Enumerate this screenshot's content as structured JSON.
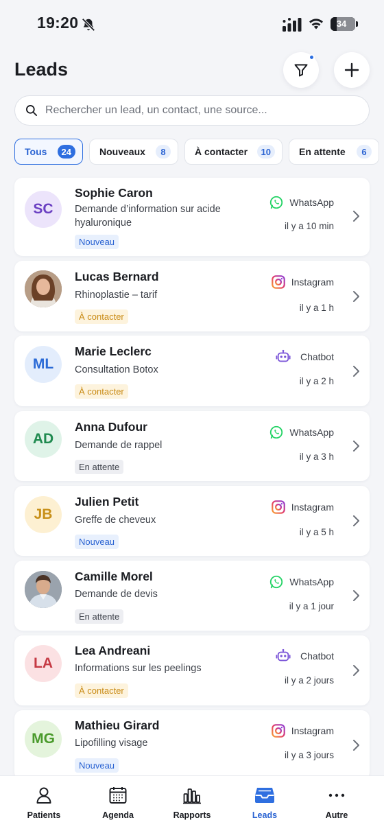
{
  "status_bar": {
    "time": "19:20",
    "battery": "34"
  },
  "header": {
    "title": "Leads"
  },
  "search": {
    "placeholder": "Rechercher un lead, un contact, une source..."
  },
  "filters": [
    {
      "label": "Tous",
      "count": "24",
      "active": true
    },
    {
      "label": "Nouveaux",
      "count": "8",
      "active": false
    },
    {
      "label": "À contacter",
      "count": "10",
      "active": false
    },
    {
      "label": "En attente",
      "count": "6",
      "active": false
    }
  ],
  "leads": [
    {
      "initials": "SC",
      "name": "Sophie Caron",
      "subject": "Demande d’information sur acide hyaluronique",
      "status": "Nouveau",
      "source": "WhatsApp",
      "time": "il y a 10 min",
      "avatar_bg": "#ece4fb",
      "avatar_fg": "#6a3fc2",
      "source_icon": "whatsapp-icon"
    },
    {
      "initials": "",
      "name": "Lucas Bernard",
      "subject": "Rhinoplastie – tarif",
      "status": "À contacter",
      "source": "Instagram",
      "time": "il y a 1 h",
      "avatar_bg": "#8a6a56",
      "avatar_fg": "#ffffff",
      "source_icon": "instagram-icon"
    },
    {
      "initials": "ML",
      "name": "Marie Leclerc",
      "subject": "Consultation Botox",
      "status": "À contacter",
      "source": "Chatbot",
      "time": "il y a 2 h",
      "avatar_bg": "#e3edfc",
      "avatar_fg": "#2a6ad6",
      "source_icon": "chatbot-icon"
    },
    {
      "initials": "AD",
      "name": "Anna Dufour",
      "subject": "Demande de rappel",
      "status": "En attente",
      "source": "WhatsApp",
      "time": "il y a 3 h",
      "avatar_bg": "#dff3e8",
      "avatar_fg": "#1f8a4f",
      "source_icon": "whatsapp-icon"
    },
    {
      "initials": "JB",
      "name": "Julien Petit",
      "subject": "Greffe de cheveux",
      "status": "Nouveau",
      "source": "Instagram",
      "time": "il y a 5 h",
      "avatar_bg": "#fdf0d2",
      "avatar_fg": "#c8901a",
      "source_icon": "instagram-icon"
    },
    {
      "initials": "",
      "name": "Camille Morel",
      "subject": "Demande de devis",
      "status": "En attente",
      "source": "WhatsApp",
      "time": "il y a 1 jour",
      "avatar_bg": "#6d7682",
      "avatar_fg": "#ffffff",
      "source_icon": "whatsapp-icon"
    },
    {
      "initials": "LA",
      "name": "Lea Andreani",
      "subject": "Informations sur les peelings",
      "status": "À contacter",
      "source": "Chatbot",
      "time": "il y a 2 jours",
      "avatar_bg": "#fbe1e3",
      "avatar_fg": "#c53a44",
      "source_icon": "chatbot-icon"
    },
    {
      "initials": "MG",
      "name": "Mathieu Girard",
      "subject": "Lipofilling visage",
      "status": "Nouveau",
      "source": "Instagram",
      "time": "il y a 3 jours",
      "avatar_bg": "#e4f4dc",
      "avatar_fg": "#4a9a2c",
      "source_icon": "instagram-icon"
    }
  ],
  "bottom_nav": [
    {
      "label": "Patients",
      "icon": "person-icon",
      "active": false
    },
    {
      "label": "Agenda",
      "icon": "calendar-icon",
      "active": false
    },
    {
      "label": "Rapports",
      "icon": "bar-chart-icon",
      "active": false
    },
    {
      "label": "Leads",
      "icon": "inbox-icon",
      "active": true
    },
    {
      "label": "Autre",
      "icon": "more-icon",
      "active": false
    }
  ],
  "colors": {
    "accent": "#2f6fe0",
    "whatsapp": "#25d366",
    "chatbot": "#7b55d8"
  }
}
